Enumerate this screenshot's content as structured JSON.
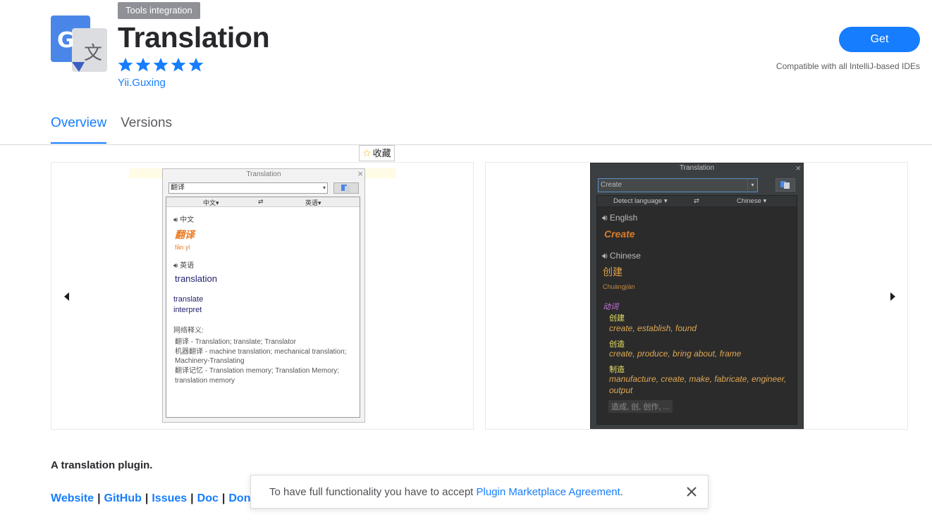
{
  "header": {
    "category": "Tools integration",
    "title": "Translation",
    "rating_stars": 5,
    "rating_max": 5,
    "vendor": "Yii.Guxing",
    "get_label": "Get",
    "compatibility": "Compatible with all IntelliJ-based IDEs"
  },
  "colors": {
    "accent": "#167dff",
    "star": "#167dff"
  },
  "tabs": [
    {
      "label": "Overview",
      "active": true
    },
    {
      "label": "Versions",
      "active": false
    }
  ],
  "favorite": {
    "label": "收藏"
  },
  "carousel": {
    "light": {
      "window_title": "Translation",
      "input_value": "翻译",
      "source_lang": "中文▾",
      "target_lang": "英语▾",
      "swap": "⇄",
      "source_label": "中文",
      "source_word": "翻译",
      "source_pinyin": "fān yì",
      "target_label": "英语",
      "target_word": "translation",
      "alternatives": [
        "translate",
        "interpret"
      ],
      "web_label": "网络释义:",
      "web_definitions": [
        "翻译 - Translation; translate; Translator",
        "机器翻译 - machine translation; mechanical translation; Machinery-Translating",
        "翻译记忆 - Translation memory; Translation Memory; translation memory"
      ]
    },
    "dark": {
      "window_title": "Translation",
      "input_value": "Create",
      "source_lang": "Detect language ▾",
      "target_lang": "Chinese ▾",
      "swap": "⇄",
      "source_label": "English",
      "source_word": "Create",
      "target_label": "Chinese",
      "target_word": "创建",
      "target_pinyin": "Chuàngjiàn",
      "part_of_speech": "动词",
      "senses": [
        {
          "word": "创建",
          "gloss": "create, establish, found"
        },
        {
          "word": "创造",
          "gloss": "create, produce, bring about, frame"
        },
        {
          "word": "制造",
          "gloss": "manufacture, create, make, fabricate, engineer, output"
        }
      ],
      "more": "造成, 创, 创作, ..."
    }
  },
  "description": {
    "summary": "A translation plugin.",
    "links": [
      "Website",
      "GitHub",
      "Issues",
      "Doc",
      "Dona"
    ],
    "separator": "|"
  },
  "notification": {
    "text_prefix": "To have full functionality you have to accept ",
    "link_label": "Plugin Marketplace Agreement",
    "text_suffix": "."
  }
}
